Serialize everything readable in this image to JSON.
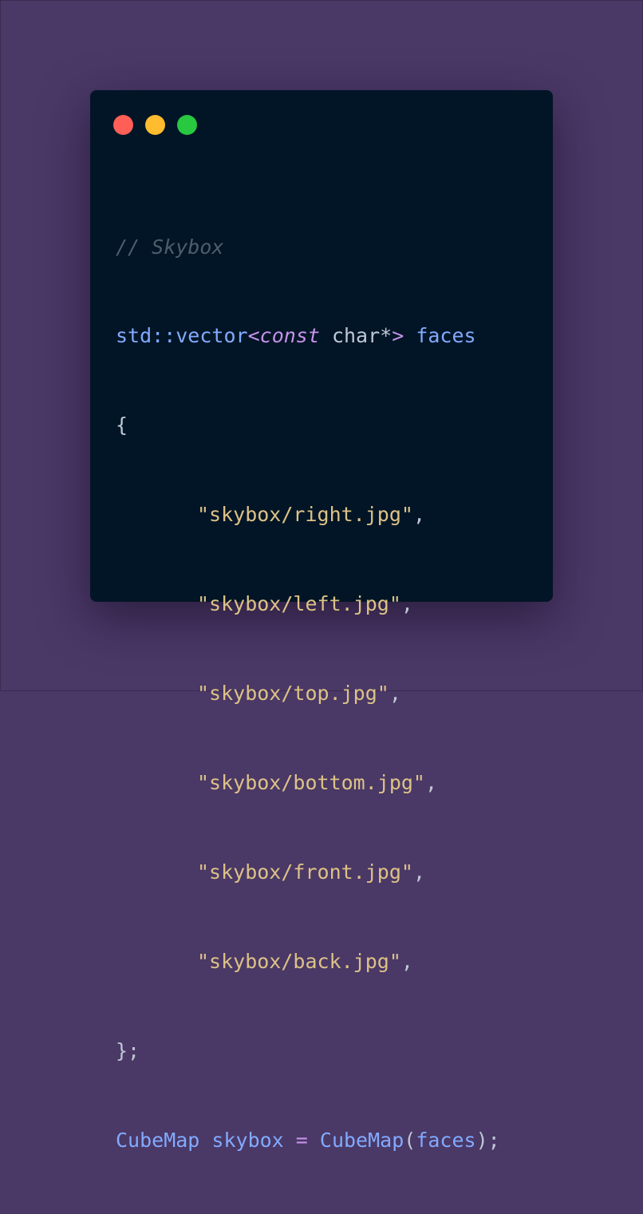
{
  "window_controls": {
    "close_color": "#ff5f57",
    "minimize_color": "#febc2e",
    "maximize_color": "#28c840"
  },
  "code": {
    "comment": "// Skybox",
    "decl_type": "std::vector",
    "lt": "<",
    "const_kw": "const",
    "char_type": " char*",
    "gt": ">",
    "var_name": " faces",
    "open_brace": "{",
    "strings": [
      "\"skybox/right.jpg\"",
      "\"skybox/left.jpg\"",
      "\"skybox/top.jpg\"",
      "\"skybox/bottom.jpg\"",
      "\"skybox/front.jpg\"",
      "\"skybox/back.jpg\""
    ],
    "comma": ",",
    "close_brace": "};",
    "cubemap_type": "CubeMap",
    "skybox_var": " skybox ",
    "equals": "=",
    "ctor": " CubeMap",
    "paren_open": "(",
    "ctor_arg": "faces",
    "paren_close": ");"
  }
}
